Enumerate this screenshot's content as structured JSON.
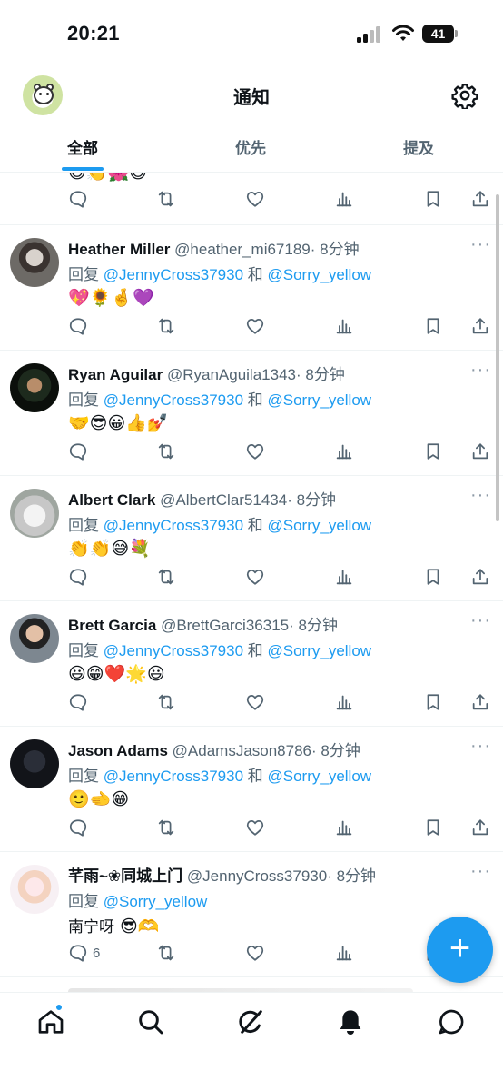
{
  "status_bar": {
    "time": "20:21",
    "battery": "41"
  },
  "header": {
    "title": "通知"
  },
  "tabs": [
    {
      "label": "全部",
      "active": true
    },
    {
      "label": "优先",
      "active": false
    },
    {
      "label": "提及",
      "active": false
    }
  ],
  "partial_top": {
    "emoji": "😄👏🌺😄"
  },
  "posts": [
    {
      "name": "Heather Miller",
      "handle": "@heather_mi67189",
      "time": "· 8分钟",
      "reply_prefix": "回复",
      "mention1": "@JennyCross37930",
      "conj": "和",
      "mention2": "@Sorry_yellow",
      "text": "💖🌻🤞💜",
      "reply_count": ""
    },
    {
      "name": "Ryan Aguilar",
      "handle": "@RyanAguila1343",
      "time": "· 8分钟",
      "reply_prefix": "回复",
      "mention1": "@JennyCross37930",
      "conj": "和",
      "mention2": "@Sorry_yellow",
      "text": "🤝😎😀👍💅",
      "reply_count": ""
    },
    {
      "name": "Albert Clark",
      "handle": "@AlbertClar51434",
      "time": "· 8分钟",
      "reply_prefix": "回复",
      "mention1": "@JennyCross37930",
      "conj": "和",
      "mention2": "@Sorry_yellow",
      "text": "👏👏😅💐",
      "reply_count": ""
    },
    {
      "name": "Brett Garcia",
      "handle": "@BrettGarci36315",
      "time": "· 8分钟",
      "reply_prefix": "回复",
      "mention1": "@JennyCross37930",
      "conj": "和",
      "mention2": "@Sorry_yellow",
      "text": "😃😁❤️🌟😃",
      "reply_count": ""
    },
    {
      "name": "Jason Adams",
      "handle": "@AdamsJason8786",
      "time": "· 8分钟",
      "reply_prefix": "回复",
      "mention1": "@JennyCross37930",
      "conj": "和",
      "mention2": "@Sorry_yellow",
      "text": "🙂🫲😁",
      "reply_count": ""
    },
    {
      "name": "芊雨~❀同城上门",
      "handle": "@JennyCross37930",
      "time": "· 8分钟",
      "reply_prefix": "回复",
      "mention1": "@Sorry_yellow",
      "conj": "",
      "mention2": "",
      "text_cn": "南宁呀",
      "text": " 😎🫶",
      "reply_count": "6"
    }
  ],
  "colors": {
    "accent": "#1d9bf0",
    "text": "#0f1419",
    "muted": "#536471",
    "divider": "#eff3f4"
  },
  "icons": {
    "reply": "reply-icon",
    "retweet": "retweet-icon",
    "like": "heart-icon",
    "views": "views-icon",
    "bookmark": "bookmark-icon",
    "share": "share-icon",
    "settings": "gear-icon",
    "compose": "plus-icon",
    "nav": [
      "home-icon",
      "search-icon",
      "grok-icon",
      "bell-icon",
      "chat-icon"
    ]
  },
  "fab": {
    "label": "+"
  }
}
